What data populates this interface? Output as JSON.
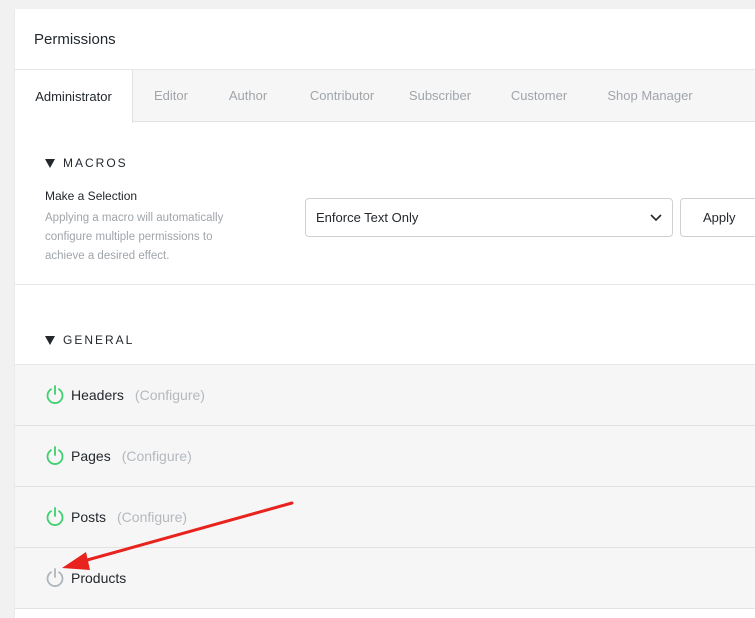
{
  "panel": {
    "title": "Permissions"
  },
  "tabs": [
    {
      "label": "Administrator",
      "active": true
    },
    {
      "label": "Editor"
    },
    {
      "label": "Author"
    },
    {
      "label": "Contributor"
    },
    {
      "label": "Subscriber"
    },
    {
      "label": "Customer"
    },
    {
      "label": "Shop Manager"
    }
  ],
  "macros": {
    "title": "MACROS",
    "label": "Make a Selection",
    "description": "Applying a macro will automatically configure multiple permissions to achieve a desired effect.",
    "select_value": "Enforce Text Only",
    "apply_label": "Apply"
  },
  "general": {
    "title": "GENERAL",
    "items": [
      {
        "label": "Headers",
        "configure": "(Configure)",
        "enabled": true
      },
      {
        "label": "Pages",
        "configure": "(Configure)",
        "enabled": true
      },
      {
        "label": "Posts",
        "configure": "(Configure)",
        "enabled": true
      },
      {
        "label": "Products",
        "enabled": false
      }
    ]
  },
  "colors": {
    "enabled": "#3ecf6e",
    "disabled": "#b0b5ba",
    "annotation": "#e8231e"
  },
  "icons": {
    "power": "power-icon",
    "caret": "caret-down-icon",
    "chevron": "chevron-down-icon"
  }
}
